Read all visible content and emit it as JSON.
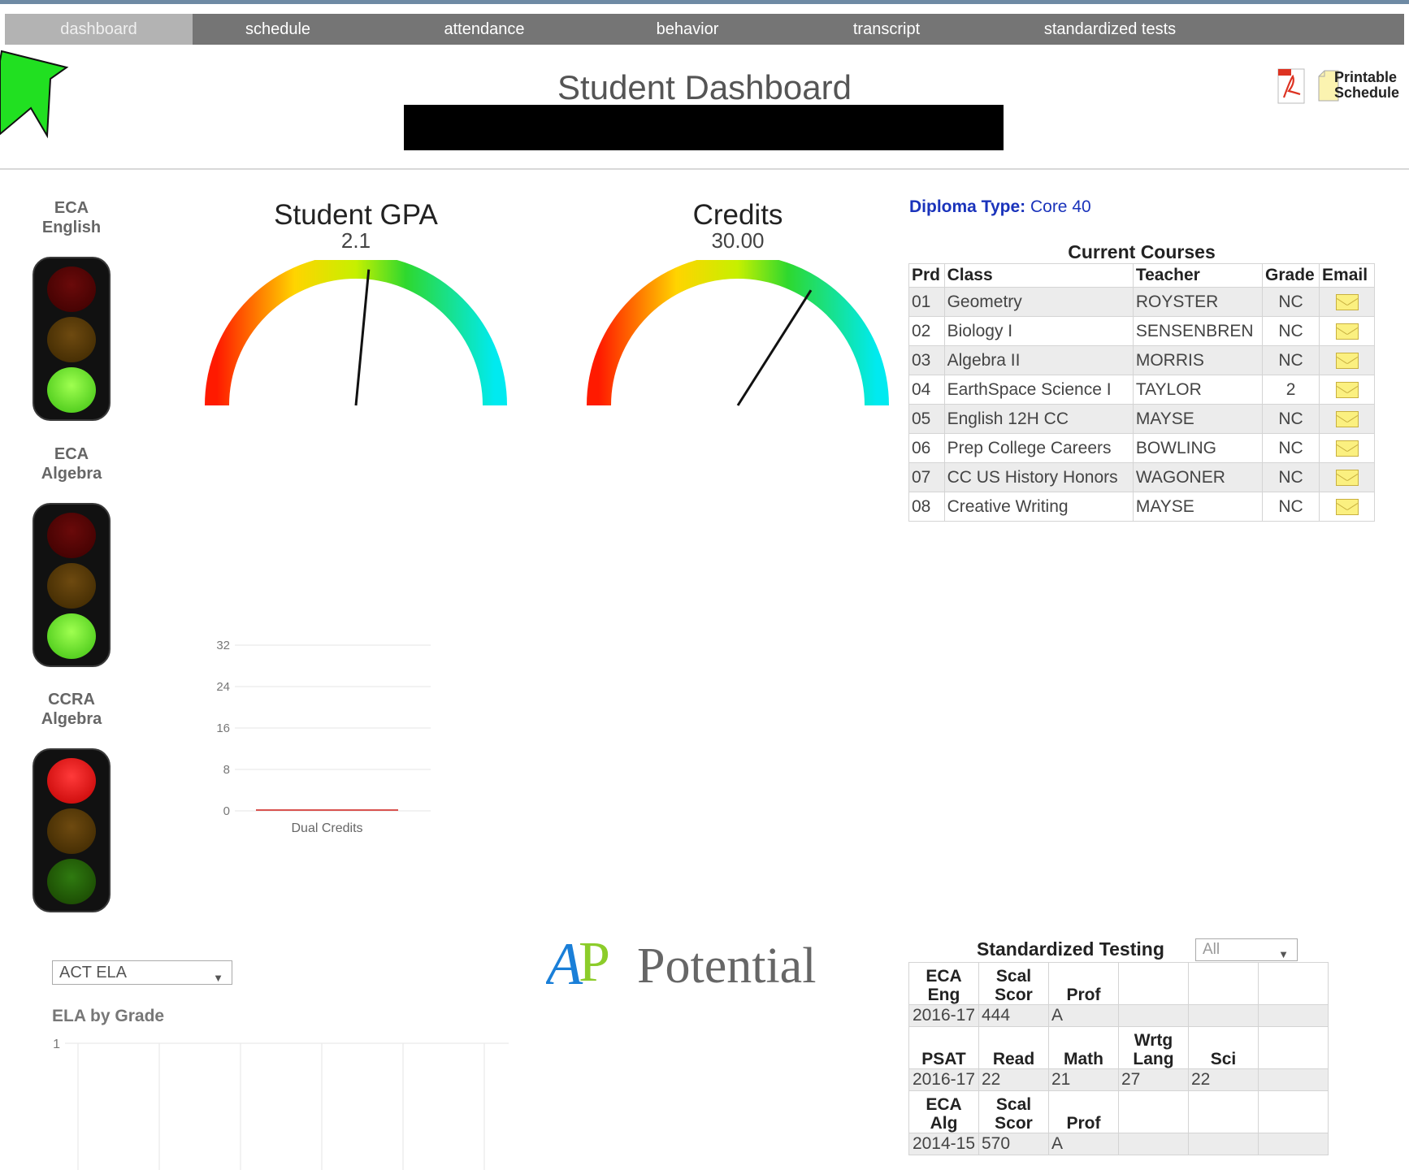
{
  "nav": {
    "tabs": [
      {
        "label": "dashboard",
        "active": true
      },
      {
        "label": "schedule"
      },
      {
        "label": "attendance"
      },
      {
        "label": "behavior"
      },
      {
        "label": "transcript"
      },
      {
        "label": "standardized tests"
      }
    ]
  },
  "page_title": "Student Dashboard",
  "toolbar": {
    "pdf_icon": "pdf-icon",
    "printable_schedule_line1": "Printable",
    "printable_schedule_line2": "Schedule"
  },
  "indicators": [
    {
      "label_line1": "ECA",
      "label_line2": "English",
      "status": "green"
    },
    {
      "label_line1": "ECA",
      "label_line2": "Algebra",
      "status": "green"
    },
    {
      "label_line1": "CCRA",
      "label_line2": "Algebra",
      "status": "red"
    }
  ],
  "gauges": [
    {
      "title": "Student GPA",
      "value_text": "2.1",
      "fraction": 0.53
    },
    {
      "title": "Credits",
      "value_text": "30.00",
      "fraction": 0.68
    }
  ],
  "diploma": {
    "label": "Diploma Type:",
    "value": "Core 40"
  },
  "courses": {
    "caption": "Current Courses",
    "headers": [
      "Prd",
      "Class",
      "Teacher",
      "Grade",
      "Email"
    ],
    "rows": [
      {
        "prd": "01",
        "class": "Geometry",
        "teacher": "ROYSTER",
        "grade": "NC"
      },
      {
        "prd": "02",
        "class": "Biology I",
        "teacher": "SENSENBREN",
        "grade": "NC"
      },
      {
        "prd": "03",
        "class": "Algebra II",
        "teacher": "MORRIS",
        "grade": "NC"
      },
      {
        "prd": "04",
        "class": "EarthSpace Science I",
        "teacher": "TAYLOR",
        "grade": "2"
      },
      {
        "prd": "05",
        "class": "English 12H CC",
        "teacher": "MAYSE",
        "grade": "NC"
      },
      {
        "prd": "06",
        "class": "Prep College Careers",
        "teacher": "BOWLING",
        "grade": "NC"
      },
      {
        "prd": "07",
        "class": "CC US History Honors",
        "teacher": "WAGONER",
        "grade": "NC"
      },
      {
        "prd": "08",
        "class": "Creative Writing",
        "teacher": "MAYSE",
        "grade": "NC"
      }
    ]
  },
  "chart_data": [
    {
      "type": "bar",
      "categories": [
        "Dual Credits"
      ],
      "values": [
        0
      ],
      "ylim": [
        0,
        32
      ],
      "yticks": [
        0,
        8,
        16,
        24,
        32
      ],
      "color": "#d9534f",
      "grid": true
    },
    {
      "type": "line",
      "title": "ELA by Grade",
      "ylim": [
        0,
        1
      ],
      "yticks": [
        1
      ],
      "grid": true,
      "series": []
    }
  ],
  "ela": {
    "select_value": "ACT ELA",
    "title": "ELA by Grade"
  },
  "logo": {
    "ap": "AP",
    "text": "Potential"
  },
  "standardized_testing": {
    "caption": "Standardized Testing",
    "filter_value": "All",
    "sections": [
      {
        "headers": [
          "ECA Eng",
          "Scal\nScor",
          "Prof",
          "",
          "",
          ""
        ],
        "row": [
          "2016-17",
          "444",
          "A",
          "",
          "",
          ""
        ]
      },
      {
        "headers": [
          "PSAT",
          "Read",
          "Math",
          "Wrtg\nLang",
          "Sci",
          ""
        ],
        "row": [
          "2016-17",
          "22",
          "21",
          "27",
          "22",
          ""
        ]
      },
      {
        "headers": [
          "ECA Alg",
          "Scal\nScor",
          "Prof",
          "",
          "",
          ""
        ],
        "row": [
          "2014-15",
          "570",
          "A",
          "",
          "",
          ""
        ]
      }
    ]
  }
}
